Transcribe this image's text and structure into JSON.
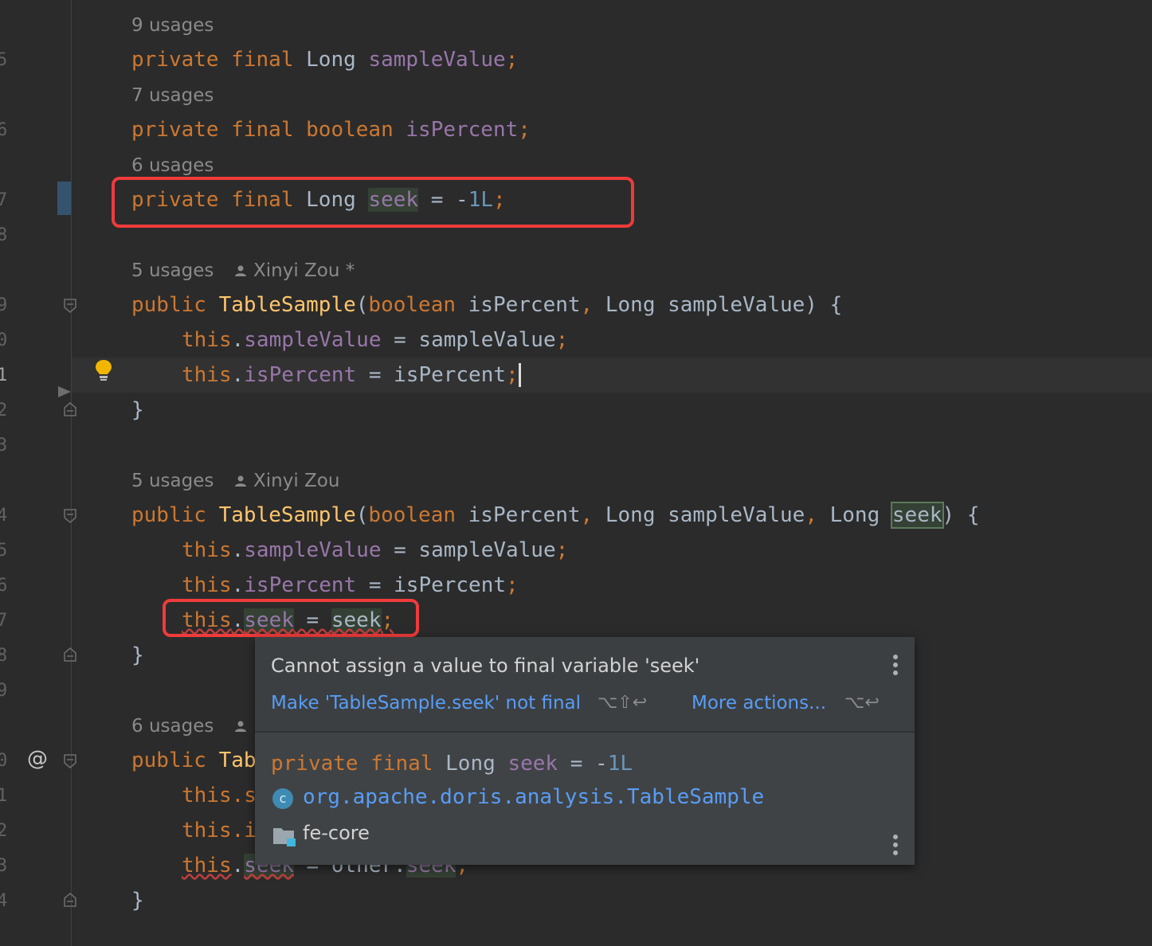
{
  "editor": {
    "line_numbers": [
      "5",
      "6",
      "7",
      "8",
      "9",
      "0",
      "1",
      "2",
      "3",
      "4",
      "5",
      "6",
      "7",
      "8",
      "9",
      "0",
      "1",
      "2",
      "3",
      "4"
    ],
    "hints": {
      "h1": "9 usages",
      "h2": "7 usages",
      "h3": "6 usages",
      "h4_usages": "5 usages",
      "h4_author": "Xinyi Zou *",
      "h5_usages": "5 usages",
      "h5_author": "Xinyi Zou",
      "h6_usages": "6 usages"
    },
    "code": {
      "l1_kw": "private final",
      "l1_type": "Long",
      "l1_field": "sampleValue",
      "l1_end": ";",
      "l2_kw": "private final boolean",
      "l2_field": "isPercent",
      "l2_end": ";",
      "l3_kw": "private final",
      "l3_type": "Long",
      "l3_field": "seek",
      "l3_op": " = -",
      "l3_num": "1L",
      "l3_end": ";",
      "c1_kw": "public",
      "c1_name": "TableSample",
      "c1_open": "(",
      "c1_kw2": "boolean",
      "c1_p1": " isPercent",
      "c1_comma": ",",
      "c1_p2": " Long sampleValue) {",
      "c1_b1_this": "this",
      "c1_b1_dot": ".",
      "c1_b1_field": "sampleValue",
      "c1_b1_rest": " = sampleValue",
      "c1_b1_end": ";",
      "c1_b2_this": "this",
      "c1_b2_dot": ".",
      "c1_b2_field": "isPercent",
      "c1_b2_rest": " = isPercent",
      "c1_b2_end": ";",
      "close": "}",
      "c2_kw": "public",
      "c2_name": "TableSample",
      "c2_open": "(",
      "c2_kw2": "boolean",
      "c2_p1": " isPercent",
      "c2_comma1": ",",
      "c2_p2": " Long sampleValue",
      "c2_comma2": ",",
      "c2_p3": " Long ",
      "c2_p3b": "seek",
      "c2_tail": ") {",
      "c2_b1_this": "this",
      "c2_b1_dot": ".",
      "c2_b1_field": "sampleValue",
      "c2_b1_rest": " = sampleValue",
      "c2_b1_end": ";",
      "c2_b2_this": "this",
      "c2_b2_dot": ".",
      "c2_b2_field": "isPercent",
      "c2_b2_rest": " = isPercent",
      "c2_b2_end": ";",
      "c2_b3_this": "this",
      "c2_b3_dot": ".",
      "c2_b3_field": "seek",
      "c2_b3_eq": " = ",
      "c2_b3_val": "seek",
      "c2_b3_end": ";",
      "c3_kw": "public",
      "c3_name": "Tab",
      "c3_b1": "this.s",
      "c3_b2": "this.i",
      "c3_b3_this": "this",
      "c3_b3_dot": ".",
      "c3_b3_field": "seek",
      "c3_b3_rest": " = other.",
      "c3_b3_val": "seek",
      "c3_b3_end": ";"
    }
  },
  "popup": {
    "title": "Cannot assign a value to final variable 'seek'",
    "action_primary": "Make 'TableSample.seek' not final",
    "action_primary_shortcut": "⌥⇧↩",
    "action_more": "More actions...",
    "action_more_shortcut": "⌥↩",
    "decl_kw": "private final",
    "decl_type": "Long",
    "decl_field": "seek",
    "decl_op": " = -",
    "decl_num": "1L",
    "class_icon_letter": "c",
    "class_fqn": "org.apache.doris.analysis.TableSample",
    "module": "fe-core"
  },
  "colors": {
    "background": "#2b2b2b",
    "keyword": "#cc7832",
    "field": "#9876aa",
    "number": "#6897bb",
    "method": "#ffc66d",
    "link": "#589df6",
    "highlight_box": "#ef3b3b"
  }
}
